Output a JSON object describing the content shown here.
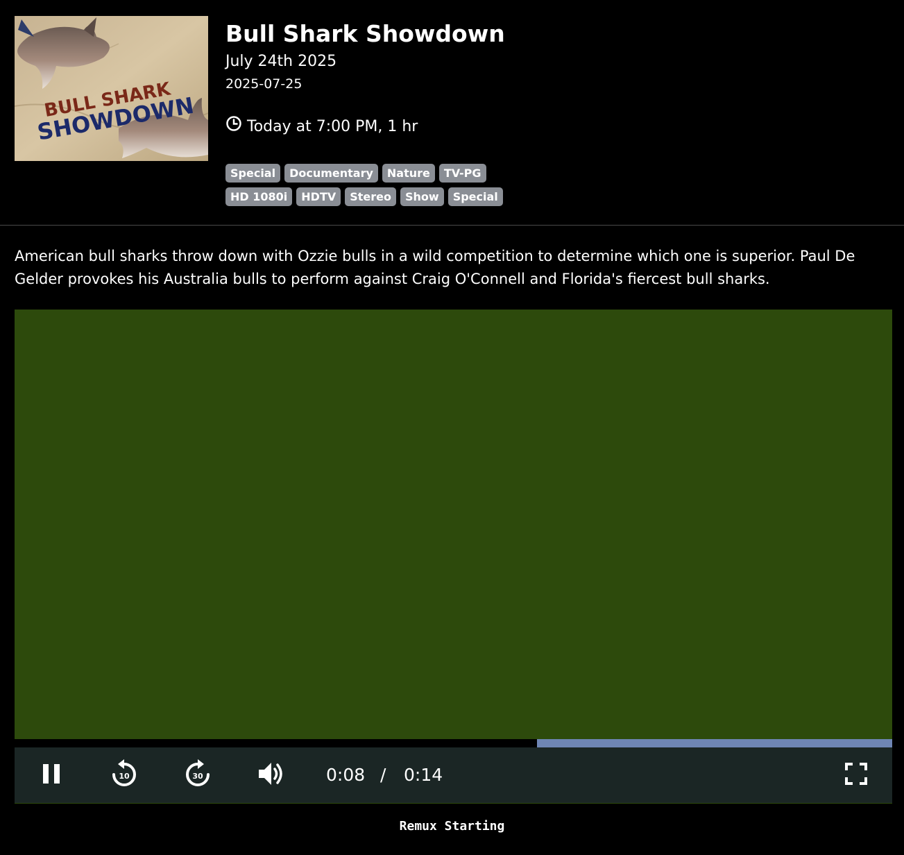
{
  "program": {
    "title": "Bull Shark Showdown",
    "date_long": "July 24th 2025",
    "date_iso": "2025-07-25",
    "airtime": "Today at 7:00 PM, 1 hr",
    "poster_text_line1": "BULL SHARK",
    "poster_text_line2": "SHOWDOWN"
  },
  "badges": {
    "row1": [
      "Special",
      "Documentary",
      "Nature",
      "TV-PG"
    ],
    "row2": [
      "HD 1080i",
      "HDTV",
      "Stereo",
      "Show",
      "Special"
    ]
  },
  "description": "American bull sharks throw down with Ozzie bulls in a wild competition to determine which one is superior. Paul De Gelder provokes his Australia bulls to perform against Craig O'Connell and Florida's fiercest bull sharks.",
  "player": {
    "current_time": "0:08",
    "separator": "/",
    "duration": "0:14",
    "buffered_fraction": 0.405,
    "rewind_label": "10",
    "forward_label": "30"
  },
  "status": "Remux Starting",
  "colors": {
    "video_bg": "#2d4a0c",
    "controls_bg": "#1b2625",
    "progress": "#6f86b4",
    "badge": "#8a8e95"
  }
}
